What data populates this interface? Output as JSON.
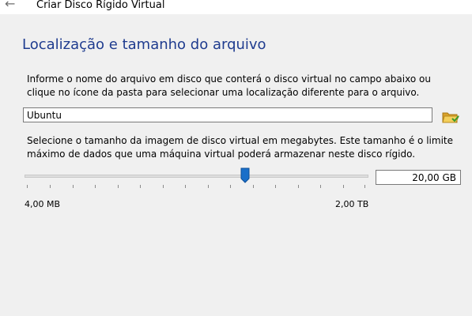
{
  "window": {
    "title": "Criar Disco Rígido Virtual"
  },
  "page": {
    "title": "Localização e tamanho do arquivo",
    "location_description": "Informe o nome do arquivo em disco que conterá o disco virtual no campo abaixo ou clique no ícone da pasta para selecionar uma localização diferente para o arquivo.",
    "file_name_value": "Ubuntu",
    "size_description": "Selecione o tamanho da imagem de disco virtual em megabytes. Este tamanho é o limite máximo de dados que uma máquina virtual poderá armazenar neste disco rígido.",
    "size_value": "20,00 GB",
    "size_min_label": "4,00 MB",
    "size_max_label": "2,00 TB",
    "slider_position_fraction": 0.64
  },
  "icons": {
    "back": "back-arrow-icon",
    "folder": "folder-open-icon"
  },
  "colors": {
    "title_blue": "#1f3c8f",
    "slider_thumb": "#1a6fc9",
    "panel_bg": "#f0f0f0"
  }
}
